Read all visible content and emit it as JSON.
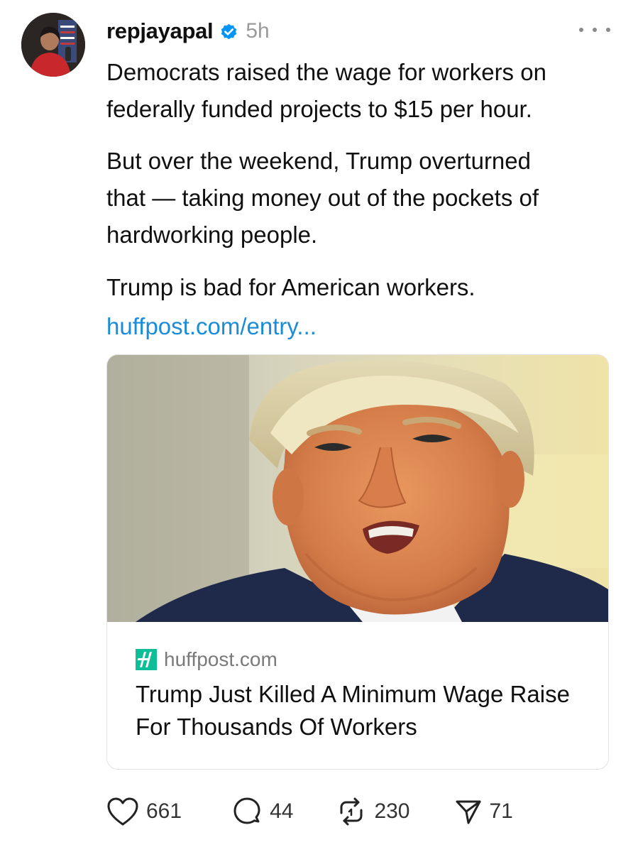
{
  "post": {
    "username": "repjayapal",
    "verified": true,
    "time": "5h",
    "paragraphs": [
      "Democrats raised the wage for workers on federally funded projects to $15 per hour.",
      "But over the weekend, Trump overturned that — taking money out of the pockets of hardworking people.",
      "Trump is bad for American workers."
    ],
    "link_text": "huffpost.com/entry..."
  },
  "card": {
    "domain": "huffpost.com",
    "title": "Trump Just Killed A Minimum Wage Raise For Thousands Of Workers"
  },
  "actions": {
    "likes": "661",
    "replies": "44",
    "reposts": "230",
    "shares": "71"
  },
  "icons": [
    "avatar",
    "verified-icon",
    "more-icon",
    "huffpost-logo-icon",
    "heart-icon",
    "comment-icon",
    "repost-icon",
    "share-icon"
  ],
  "colors": {
    "link": "#1a8cd8",
    "verified": "#0095f6",
    "huffpost": "#0dbe98",
    "muted": "#9a9a9a"
  }
}
